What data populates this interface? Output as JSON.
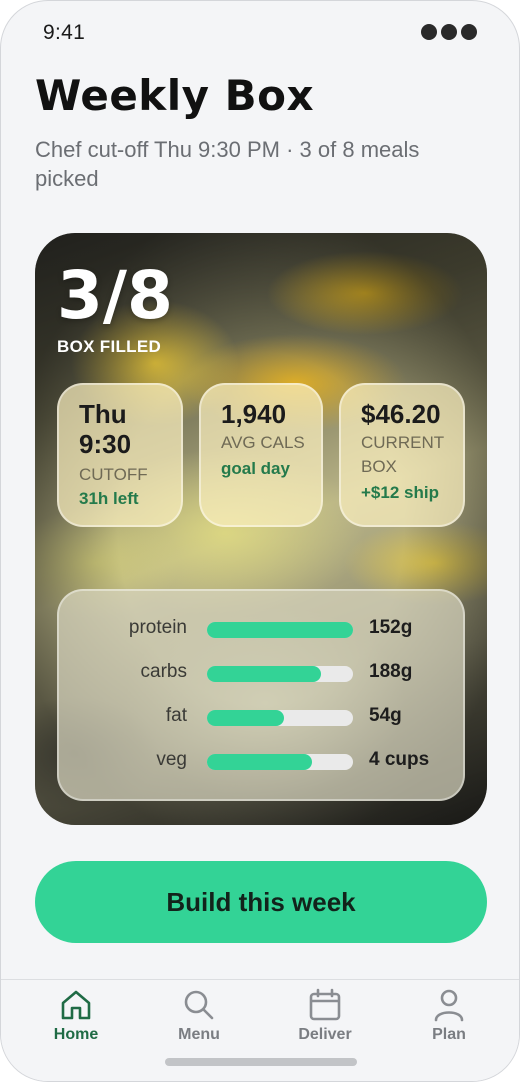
{
  "status_bar": {
    "time": "9:41"
  },
  "header": {
    "title": "Weekly Box",
    "subtitle": "Chef cut-off Thu 9:30 PM · 3 of 8 meals picked"
  },
  "hero": {
    "ratio": "3/8",
    "label": "BOX FILLED",
    "filled": 3,
    "total": 8
  },
  "stat_cards": [
    {
      "value": "Thu 9:30",
      "label": "CUTOFF",
      "note": "31h left"
    },
    {
      "value": "1,940",
      "label": "AVG CALS",
      "note": "goal day"
    },
    {
      "value": "$46.20",
      "label": "CURRENT BOX",
      "note": "+$12 ship"
    }
  ],
  "macros": [
    {
      "name": "protein",
      "value": "152g",
      "fill": 1.0
    },
    {
      "name": "carbs",
      "value": "188g",
      "fill": 0.78
    },
    {
      "name": "fat",
      "value": "54g",
      "fill": 0.53
    },
    {
      "name": "veg",
      "value": "4 cups",
      "fill": 0.72
    }
  ],
  "cta": {
    "label": "Build this week"
  },
  "tabbar": {
    "items": [
      {
        "label": "Home",
        "icon": "home-icon",
        "active": true
      },
      {
        "label": "Menu",
        "icon": "search-icon",
        "active": false
      },
      {
        "label": "Deliver",
        "icon": "calendar-icon",
        "active": false
      },
      {
        "label": "Plan",
        "icon": "person-icon",
        "active": false
      }
    ]
  },
  "colors": {
    "accent": "#33d396",
    "active_tab": "#1f6b45",
    "note_green": "#247a4b",
    "background": "#f4f5f7"
  }
}
